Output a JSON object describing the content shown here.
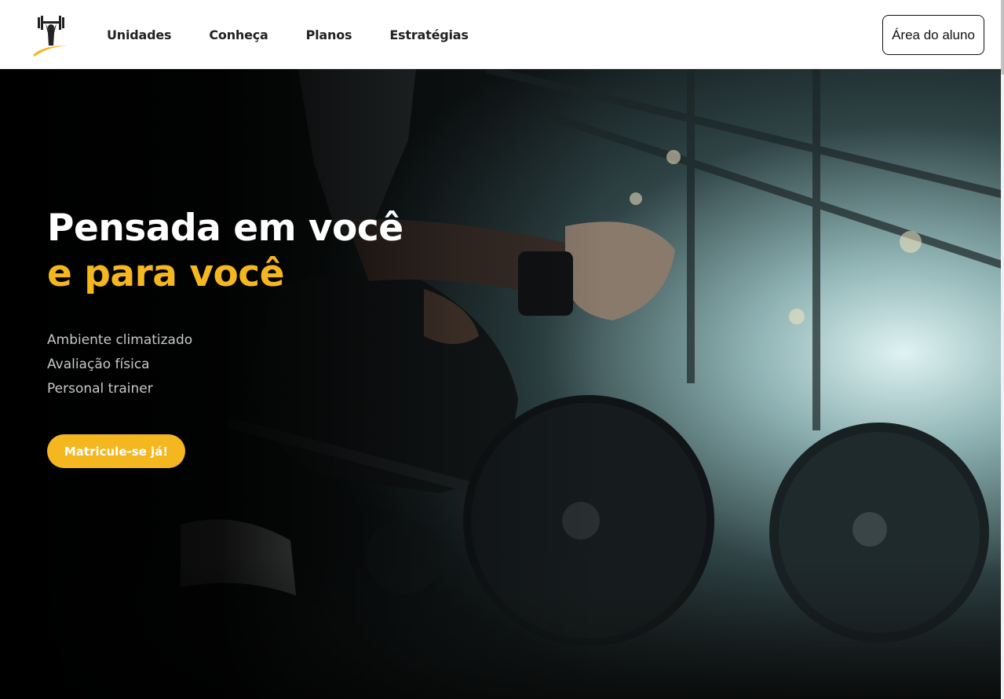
{
  "header": {
    "logo": "dumbbell-logo",
    "nav": [
      "Unidades",
      "Conheça",
      "Planos",
      "Estratégias"
    ],
    "student_area_label": "Área do aluno"
  },
  "hero": {
    "headline_line1": "Pensada em você",
    "headline_line2": "e para você",
    "features": [
      "Ambiente climatizado",
      "Avaliação física",
      "Personal trainer"
    ],
    "cta_label": "Matricule-se já!",
    "background_image": "athlete-kneeling-by-barbell-photo"
  },
  "colors": {
    "accent": "#f4b71f",
    "text_dark": "#222222",
    "hero_bg": "#0b0f10"
  }
}
